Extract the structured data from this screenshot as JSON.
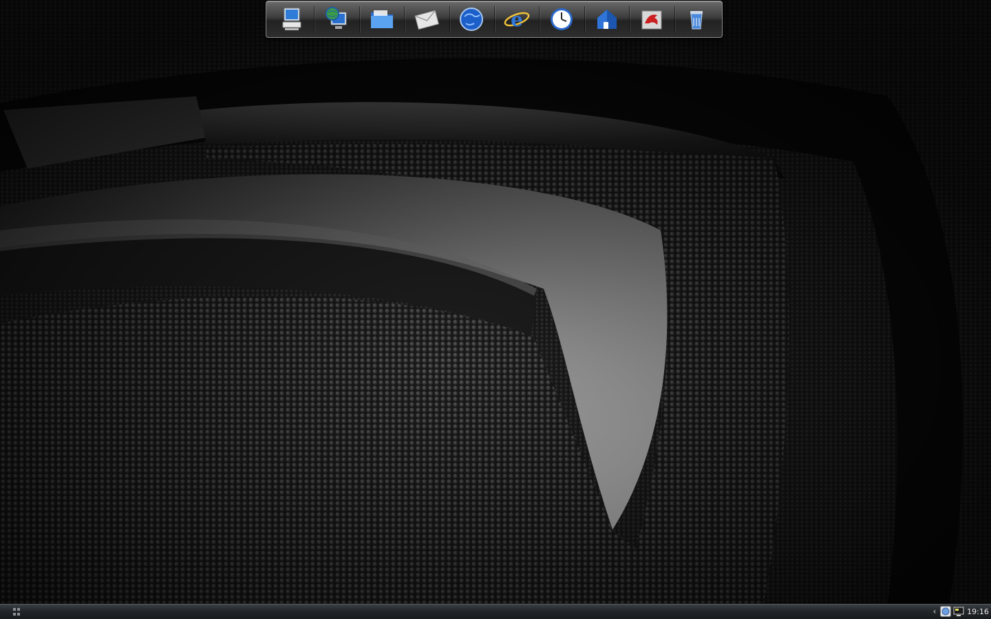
{
  "dock": {
    "items": [
      {
        "name": "my-computer",
        "icon": "computer-icon"
      },
      {
        "name": "network",
        "icon": "network-globe-icon"
      },
      {
        "name": "folder",
        "icon": "folder-icon"
      },
      {
        "name": "mail",
        "icon": "envelope-icon"
      },
      {
        "name": "web-browser",
        "icon": "globe-icon"
      },
      {
        "name": "internet-explorer",
        "icon": "ie-e-icon"
      },
      {
        "name": "clock",
        "icon": "clock-icon"
      },
      {
        "name": "home",
        "icon": "home-icon"
      },
      {
        "name": "dragon-app",
        "icon": "dragon-icon"
      },
      {
        "name": "recycle-bin",
        "icon": "trash-icon"
      }
    ]
  },
  "taskbar": {
    "tray_expand_label": "‹",
    "clock": "19:16"
  },
  "colors": {
    "dock_accent": "#2f6fd6",
    "taskbar_bg": "#24282c"
  }
}
